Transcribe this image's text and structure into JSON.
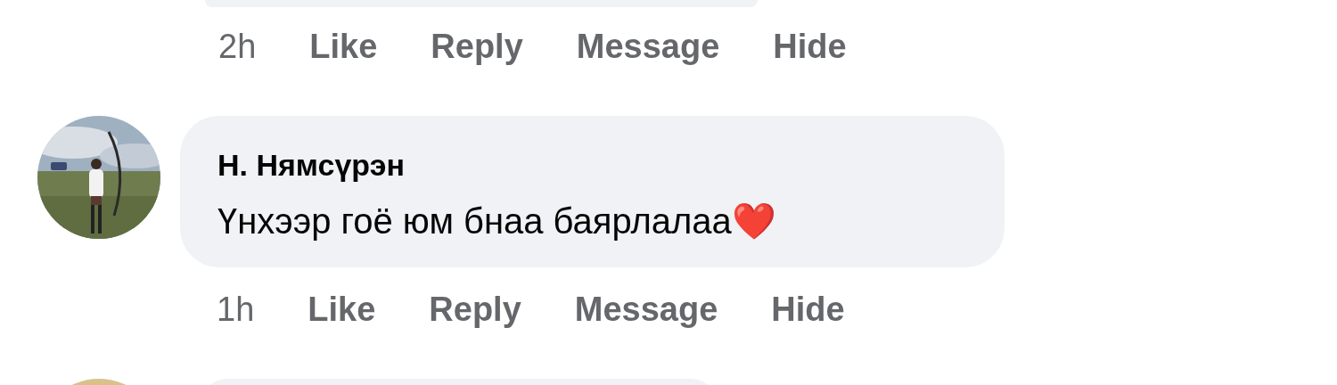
{
  "comments": [
    {
      "time": "2h",
      "actions": [
        "Like",
        "Reply",
        "Message",
        "Hide"
      ]
    },
    {
      "author": "Н. Нямсүрэн",
      "text": "Үнхээр гоё юм бнаа баярлалаа",
      "emoji": "❤️",
      "time": "1h",
      "actions": [
        "Like",
        "Reply",
        "Message",
        "Hide"
      ]
    }
  ]
}
